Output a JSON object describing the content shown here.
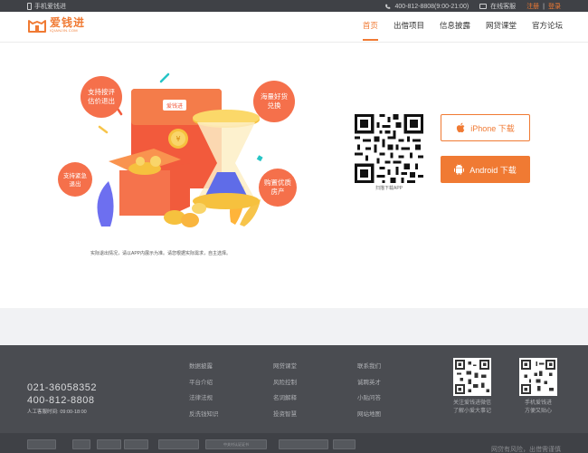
{
  "topbar": {
    "mobile_label": "手机爱钱进",
    "phone": "400-812-8808(9:00-21:00)",
    "online_service": "在线客服",
    "register": "注册",
    "separator": "|",
    "login": "登录"
  },
  "header": {
    "logo_cn": "爱钱进",
    "logo_en": "IQIANJIN.COM",
    "nav": [
      {
        "label": "首页",
        "active": true
      },
      {
        "label": "出借项目"
      },
      {
        "label": "信息披露"
      },
      {
        "label": "网贷课堂"
      },
      {
        "label": "官方论坛"
      }
    ]
  },
  "main": {
    "bubbles": [
      "支持按评估价退出",
      "海量好货兑换",
      "支持紧急退出",
      "购置优质房产"
    ],
    "envelope_label": "爱钱进",
    "note": "实际退出情况，请以APP内展示为准。请您根据实际需求，自主选择。",
    "qr_caption": "扫描下载APP",
    "iphone_btn": "iPhone 下载",
    "android_btn": "Android 下载"
  },
  "footer": {
    "phone1": "021-36058352",
    "phone2": "400-812-8808",
    "hours_label": "人工客服时间:",
    "hours_value": "09:00-18:00",
    "col1": [
      "数据披露",
      "平台介绍",
      "法律法规",
      "反洗钱知识"
    ],
    "col2": [
      "网贷课堂",
      "风险控制",
      "名词解释",
      "投资智慧"
    ],
    "col3": [
      "联系我们",
      "诚聘英才",
      "小贴问答",
      "网站地图"
    ],
    "qr1_caption": [
      "关注爱钱进微信",
      "了解小爱大事记"
    ],
    "qr2_caption": [
      "手机爱钱进",
      "方便又贴心"
    ],
    "badges": [
      "",
      "",
      "",
      "",
      "",
      "中关村认证证书",
      "",
      ""
    ],
    "copyright": "网贷有风险，出借需谨慎"
  },
  "colors": {
    "accent": "#f07a33",
    "footer_bg": "#4a4c51",
    "topbar_bg": "#3f4146"
  }
}
